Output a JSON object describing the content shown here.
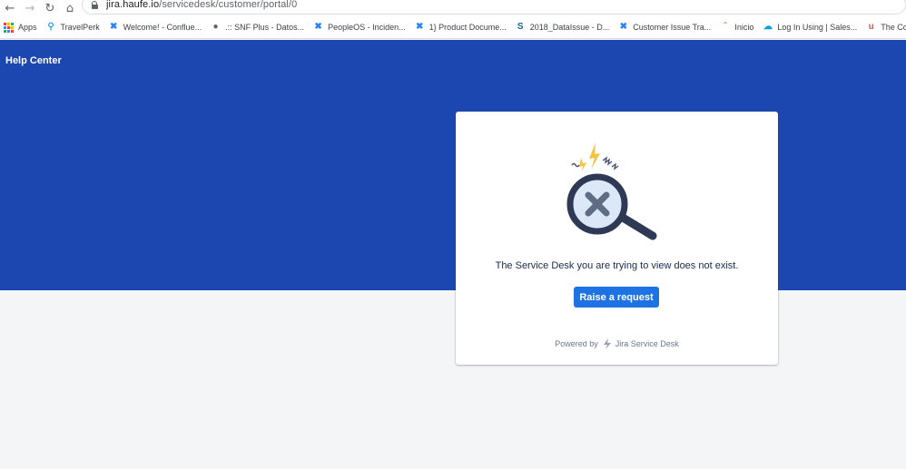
{
  "browser": {
    "url_host": "jira.haufe.io",
    "url_path": "/servicedesk/customer/portal/0",
    "nav": {
      "back_glyph": "←",
      "forward_glyph": "→",
      "reload_glyph": "↻",
      "home_glyph": "⌂"
    },
    "bookmarks": [
      {
        "label": "Apps",
        "icon": "apps-grid-icon"
      },
      {
        "label": "TravelPerk",
        "icon": "map-pin-icon",
        "color": "#2aa7de",
        "glyph": "⚲"
      },
      {
        "label": "Welcome! - Conflue...",
        "icon": "confluence-icon",
        "color": "#2684ff",
        "glyph": "✖"
      },
      {
        "label": ".:: SNF Plus - Datos...",
        "icon": "globe-icon",
        "color": "#5f6368",
        "glyph": "●"
      },
      {
        "label": "PeopleOS - Inciden...",
        "icon": "jira-icon",
        "color": "#2684ff",
        "glyph": "✖"
      },
      {
        "label": "1} Product Docume...",
        "icon": "confluence-icon",
        "color": "#2684ff",
        "glyph": "✖"
      },
      {
        "label": "2018_DataIssue - D...",
        "icon": "sharepoint-icon",
        "color": "#0b6a9b",
        "glyph": "S"
      },
      {
        "label": "Customer Issue Tra...",
        "icon": "jira-icon",
        "color": "#2684ff",
        "glyph": "✖"
      },
      {
        "label": "Inicio",
        "icon": "swoosh-icon",
        "color": "#f36c21",
        "glyph": "ˆ"
      },
      {
        "label": "Log In Using | Sales...",
        "icon": "salesforce-cloud-icon",
        "color": "#00a1e0",
        "glyph": "☁"
      },
      {
        "label": "The Comple",
        "icon": "udemy-icon",
        "color": "#ea5252",
        "glyph": "u"
      }
    ]
  },
  "header": {
    "title": "Help Center"
  },
  "card": {
    "message": "The Service Desk you are trying to view does not exist.",
    "button_label": "Raise a request",
    "powered_by_prefix": "Powered by",
    "powered_by_product": "Jira Service Desk"
  },
  "colors": {
    "hero_blue": "#1c47b0",
    "button_blue": "#1e72e3",
    "page_background": "#f4f5f7",
    "bolt_yellow": "#f6c342",
    "magnifier_dark": "#2e3a55",
    "magnifier_glass": "#dce8f7"
  }
}
